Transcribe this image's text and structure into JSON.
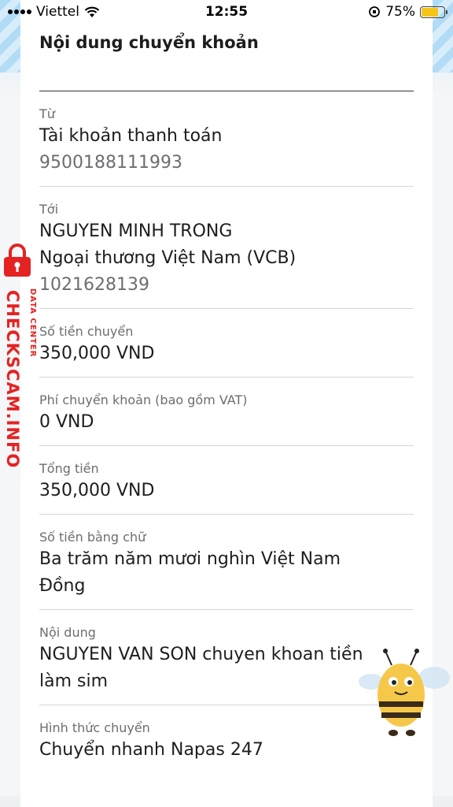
{
  "status_bar": {
    "carrier": "Viettel",
    "time": "12:55",
    "battery_percent": "75%",
    "battery_level": 0.75
  },
  "card": {
    "title": "Nội dung chuyển khoản"
  },
  "details": [
    {
      "label": "Từ",
      "values": [
        "Tài khoản thanh toán"
      ],
      "sub": "9500188111993"
    },
    {
      "label": "Tới",
      "values": [
        "NGUYEN MINH TRONG",
        "Ngoại thương Việt Nam (VCB)"
      ],
      "sub": "1021628139"
    },
    {
      "label": "Số tiền chuyển",
      "values": [
        "350,000 VND"
      ]
    },
    {
      "label": "Phí chuyển khoản (bao gồm VAT)",
      "values": [
        "0 VND"
      ]
    },
    {
      "label": "Tổng tiền",
      "values": [
        "350,000 VND"
      ]
    },
    {
      "label": "Số tiền bằng chữ",
      "values": [
        "Ba trăm năm mươi nghìn Việt Nam",
        "Đồng"
      ]
    },
    {
      "label": "Nội dung",
      "values": [
        "NGUYEN VAN SON chuyen khoan tiền",
        "làm sim"
      ]
    },
    {
      "label": "Hình thức chuyển",
      "values": [
        "Chuyển nhanh Napas 247"
      ]
    }
  ],
  "watermark": {
    "main": "CHECKSCAM.INFO",
    "sub": "DATA CENTER"
  },
  "colors": {
    "watermark_red": "#e52222",
    "background_blue": "#d6ecfa"
  }
}
